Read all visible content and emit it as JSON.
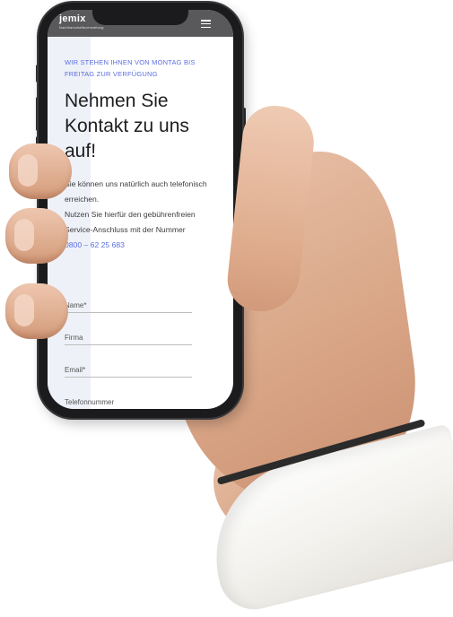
{
  "brand": {
    "name": "jemix",
    "tagline": "Nachbarschaftsverwaltung"
  },
  "header": {
    "menu_icon": "hamburger-menu-icon"
  },
  "content": {
    "eyebrow": "WIR STEHEN IHNEN VON MONTAG BIS FREITAG ZUR VERFÜGUNG",
    "headline": "Nehmen Sie Kontakt zu uns auf!",
    "body_line1": "Sie können uns natürlich auch telefonisch erreichen.",
    "body_line2": "Nutzen Sie hierfür den gebührenfreien Service-Anschluss mit der Nummer",
    "phone_number": "0800 – 62 25 683"
  },
  "form": {
    "fields": [
      {
        "label": "Name*"
      },
      {
        "label": "Firma"
      },
      {
        "label": "Email*"
      },
      {
        "label": "Telefonnummer"
      }
    ]
  },
  "colors": {
    "accent": "#5b6ee1",
    "header_bg": "#59595c",
    "text": "#1e1e1e"
  }
}
